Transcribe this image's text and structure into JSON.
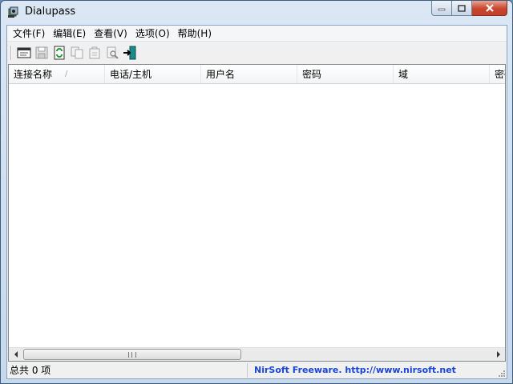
{
  "window": {
    "title": "Dialupass"
  },
  "menu": [
    {
      "label": "文件(F)"
    },
    {
      "label": "编辑(E)"
    },
    {
      "label": "查看(V)"
    },
    {
      "label": "选项(O)"
    },
    {
      "label": "帮助(H)"
    }
  ],
  "toolbar": {
    "buttons": [
      {
        "icon": "properties-icon",
        "enabled": true
      },
      {
        "icon": "save-icon",
        "enabled": false
      },
      {
        "icon": "refresh-icon",
        "enabled": true
      },
      {
        "icon": "copy-icon",
        "enabled": false
      },
      {
        "icon": "html-report-icon",
        "enabled": false
      },
      {
        "icon": "find-icon",
        "enabled": false
      },
      {
        "icon": "exit-icon",
        "enabled": true
      }
    ]
  },
  "list": {
    "columns": [
      {
        "label": "连接名称",
        "sorted": true
      },
      {
        "label": "电话/主机"
      },
      {
        "label": "用户名"
      },
      {
        "label": "密码"
      },
      {
        "label": "域"
      },
      {
        "label": "密码"
      }
    ],
    "rows": []
  },
  "status": {
    "count_text": "总共 0 项",
    "link_text": "NirSoft Freeware.  http://www.nirsoft.net",
    "link_color": "#1846d6"
  }
}
